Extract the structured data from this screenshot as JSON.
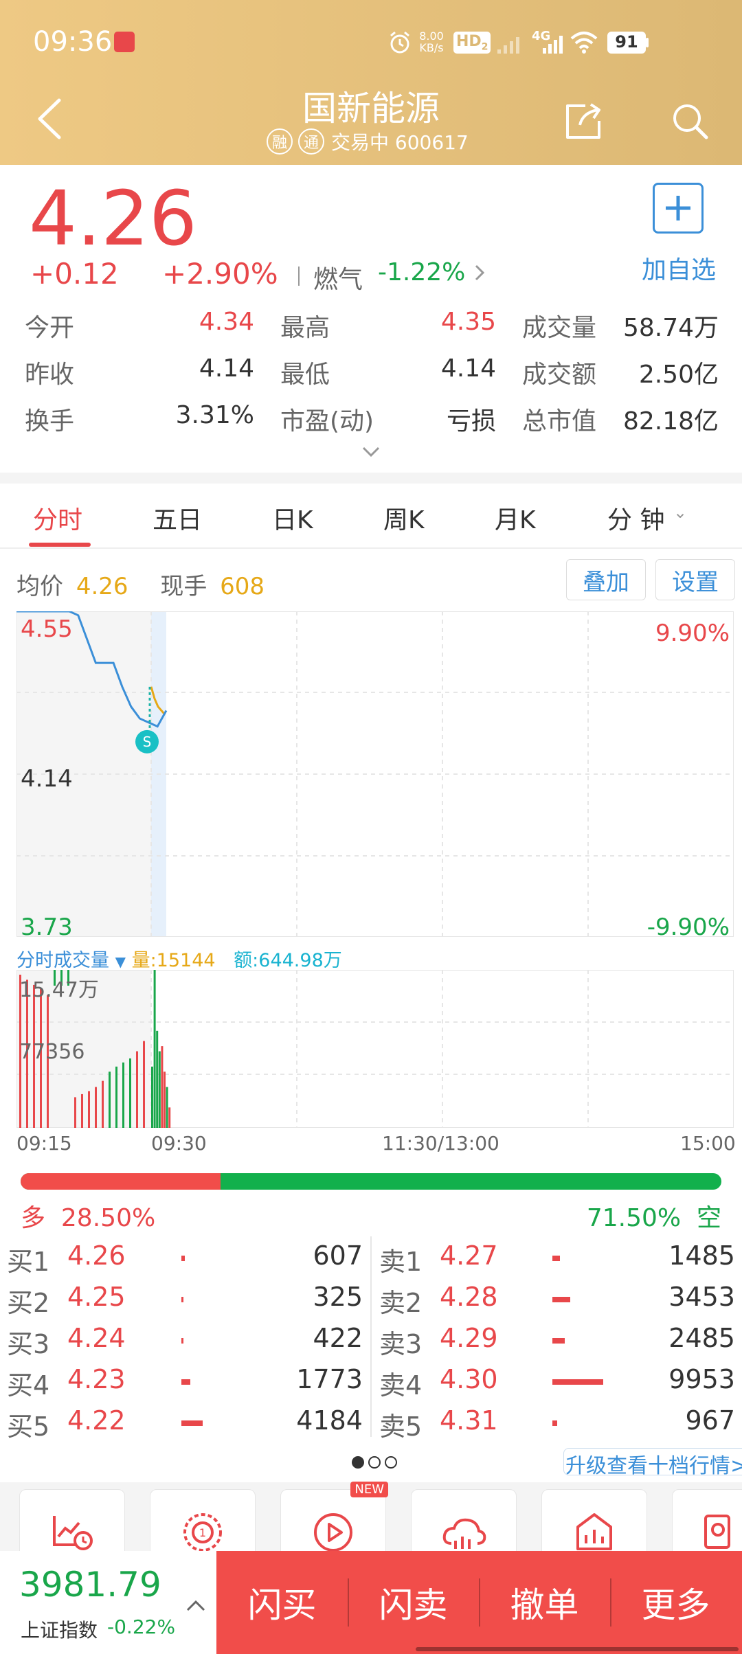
{
  "status": {
    "time": "09:36",
    "net_speed_top": "8.00",
    "net_speed_bottom": "KB/s",
    "hd": "HD",
    "hd_sub": "2",
    "signal": "4G",
    "battery": "91"
  },
  "nav": {
    "title": "国新能源",
    "badge_rong": "融",
    "badge_tong": "通",
    "status_code": "交易中 600617"
  },
  "quote": {
    "price": "4.26",
    "change": "+0.12",
    "change_pct": "+2.90%",
    "sector": "燃气",
    "sector_pct": "-1.22%",
    "add_watch": "加自选",
    "rows": [
      [
        {
          "l": "今开",
          "v": "4.34",
          "c": "red"
        },
        {
          "l": "最高",
          "v": "4.35",
          "c": "red"
        },
        {
          "l": "成交量",
          "v": "58.74万",
          "c": "dark"
        }
      ],
      [
        {
          "l": "昨收",
          "v": "4.14",
          "c": "dark"
        },
        {
          "l": "最低",
          "v": "4.14",
          "c": "dark"
        },
        {
          "l": "成交额",
          "v": "2.50亿",
          "c": "dark"
        }
      ],
      [
        {
          "l": "换手",
          "v": "3.31%",
          "c": "dark"
        },
        {
          "l": "市盈(动)",
          "v": "亏损",
          "c": "dark"
        },
        {
          "l": "总市值",
          "v": "82.18亿",
          "c": "dark"
        }
      ]
    ]
  },
  "tabs": [
    "分时",
    "五日",
    "日K",
    "周K",
    "月K",
    "分 钟"
  ],
  "chart_info": {
    "avg_label": "均价",
    "avg_val": "4.26",
    "hand_label": "现手",
    "hand_val": "608",
    "overlay_btn": "叠加",
    "settings_btn": "设置"
  },
  "chart_data": {
    "type": "line",
    "y_labels": {
      "top": "4.55",
      "mid": "4.14",
      "bottom": "3.73",
      "top_pct": "9.90%",
      "bottom_pct": "-9.90%"
    },
    "ylim": [
      3.73,
      4.55
    ],
    "x_labels": [
      "09:15",
      "09:30",
      "11:30/13:00",
      "15:00"
    ],
    "price_series": [
      4.55,
      4.55,
      4.55,
      4.55,
      4.55,
      4.55,
      4.55,
      4.54,
      4.48,
      4.42,
      4.42,
      4.42,
      4.36,
      4.31,
      4.28,
      4.27,
      4.26,
      4.3
    ],
    "avg_series": [
      4.36,
      4.33,
      4.31,
      4.3,
      4.29
    ],
    "marker": "S",
    "volume_title": "分时成交量",
    "volume_qty": "量:15144",
    "volume_amt": "额:644.98万",
    "volume_labels": {
      "top": "15.47万",
      "mid": "77356"
    },
    "vol_max": 154700,
    "pre_bars": [
      {
        "v": 150000,
        "c": "red"
      },
      {
        "v": 145000,
        "c": "red"
      },
      {
        "v": 140000,
        "c": "red"
      },
      {
        "v": 136000,
        "c": "red"
      },
      {
        "v": 130000,
        "c": "red"
      },
      {
        "v": 150000,
        "c": "green"
      },
      {
        "v": 152000,
        "c": "green"
      },
      {
        "v": 150000,
        "c": "green"
      },
      {
        "v": 30000,
        "c": "red"
      },
      {
        "v": 33000,
        "c": "red"
      },
      {
        "v": 36000,
        "c": "red"
      },
      {
        "v": 40000,
        "c": "red"
      },
      {
        "v": 46000,
        "c": "red"
      },
      {
        "v": 55000,
        "c": "green"
      },
      {
        "v": 60000,
        "c": "green"
      },
      {
        "v": 64000,
        "c": "green"
      },
      {
        "v": 68000,
        "c": "green"
      },
      {
        "v": 75000,
        "c": "red"
      },
      {
        "v": 85000,
        "c": "red"
      }
    ],
    "post_bars": [
      {
        "v": 60000,
        "c": "green"
      },
      {
        "v": 154700,
        "c": "green"
      },
      {
        "v": 95000,
        "c": "green"
      },
      {
        "v": 75000,
        "c": "green"
      },
      {
        "v": 80000,
        "c": "red"
      },
      {
        "v": 55000,
        "c": "red"
      },
      {
        "v": 40000,
        "c": "green"
      },
      {
        "v": 20000,
        "c": "red"
      }
    ]
  },
  "ratio": {
    "bull_label": "多",
    "bull_pct": "28.50%",
    "bear_pct": "71.50%",
    "bear_label": "空",
    "bull_value": 28.5
  },
  "orderbook": {
    "buy": [
      {
        "l": "买1",
        "p": "4.26",
        "q": "607",
        "vol": 607
      },
      {
        "l": "买2",
        "p": "4.25",
        "q": "325",
        "vol": 325
      },
      {
        "l": "买3",
        "p": "4.24",
        "q": "422",
        "vol": 422
      },
      {
        "l": "买4",
        "p": "4.23",
        "q": "1773",
        "vol": 1773
      },
      {
        "l": "买5",
        "p": "4.22",
        "q": "4184",
        "vol": 4184
      }
    ],
    "sell": [
      {
        "l": "卖1",
        "p": "4.27",
        "q": "1485",
        "vol": 1485
      },
      {
        "l": "卖2",
        "p": "4.28",
        "q": "3453",
        "vol": 3453
      },
      {
        "l": "卖3",
        "p": "4.29",
        "q": "2485",
        "vol": 2485
      },
      {
        "l": "卖4",
        "p": "4.30",
        "q": "9953",
        "vol": 9953
      },
      {
        "l": "卖5",
        "p": "4.31",
        "q": "967",
        "vol": 967
      }
    ],
    "upgrade": "升级查看十档行情>"
  },
  "tiles_new": "NEW",
  "bottom": {
    "index_val": "3981.79",
    "index_name": "上证指数",
    "index_pct": "-0.22%",
    "btn1": "闪买",
    "btn2": "闪卖",
    "btn3": "撤单",
    "btn4": "更多"
  },
  "colors": {
    "red": "#e8474a",
    "green": "#19a64a",
    "blue": "#3b8fd8",
    "gold": "#e6a817"
  }
}
